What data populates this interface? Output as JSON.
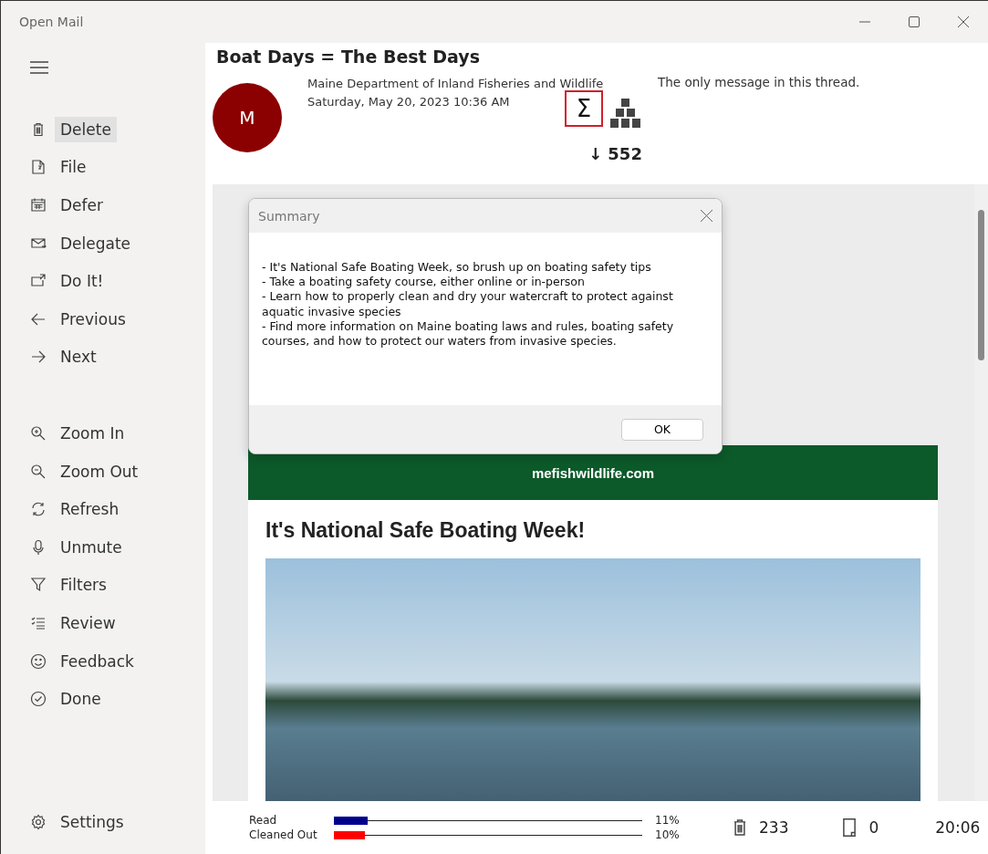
{
  "window": {
    "title": "Open Mail"
  },
  "sidebar": {
    "actions": [
      {
        "label": "Delete",
        "selected": true
      },
      {
        "label": "File",
        "selected": false
      },
      {
        "label": "Defer",
        "selected": false
      },
      {
        "label": "Delegate",
        "selected": false
      },
      {
        "label": "Do It!",
        "selected": false
      },
      {
        "label": "Previous",
        "selected": false
      },
      {
        "label": "Next",
        "selected": false
      }
    ],
    "tools": [
      {
        "label": "Zoom In",
        "selected": false
      },
      {
        "label": "Zoom Out",
        "selected": false
      },
      {
        "label": "Refresh",
        "selected": false
      },
      {
        "label": "Unmute",
        "selected": false
      },
      {
        "label": "Filters",
        "selected": false
      },
      {
        "label": "Review",
        "selected": false
      },
      {
        "label": "Feedback",
        "selected": false
      },
      {
        "label": "Done",
        "selected": false
      }
    ],
    "settings": {
      "label": "Settings"
    }
  },
  "message": {
    "subject": "Boat Days = The Best Days",
    "avatar": "M",
    "sender": "Maine Department of Inland Fisheries and Wildlife",
    "date": "Saturday, May 20, 2023 10:36 AM",
    "summary_button": {
      "label": "Σ",
      "highlighted": true
    },
    "count": "↓ 552",
    "thread_note": "The only message in this thread."
  },
  "email": {
    "banner": "mefishwildlife.com",
    "heading": "It's National Safe Boating Week!"
  },
  "dialog": {
    "title": "Summary",
    "lines": [
      "- It's National Safe Boating Week, so brush up on boating safety tips",
      "- Take a boating safety course, either online or in-person",
      "- Learn how to properly clean and dry your watercraft to protect against aquatic invasive species",
      "- Find more information on Maine boating laws and rules, boating safety courses, and how to protect our waters from invasive species."
    ],
    "ok": "OK"
  },
  "status_bar": {
    "progress": [
      {
        "label": "Read",
        "level": 0.11,
        "reading": "11%",
        "color": "#00008b"
      },
      {
        "label": "Cleaned Out",
        "level": 0.1,
        "reading": "10%",
        "color": "#ff0000"
      }
    ],
    "deleted": "233",
    "filed": "0",
    "time": "20:06"
  }
}
